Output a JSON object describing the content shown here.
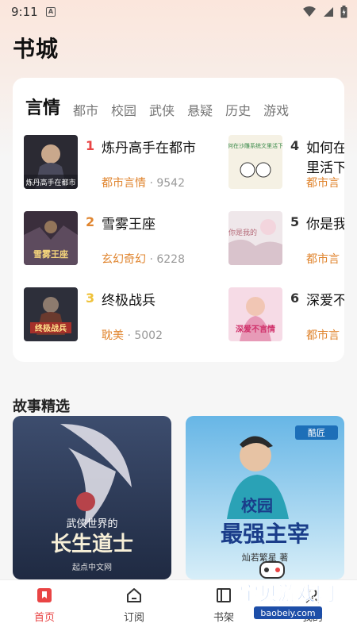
{
  "status": {
    "time": "9:11",
    "app_icon": "A"
  },
  "page_title": "书城",
  "tabs": [
    "言情",
    "都市",
    "校园",
    "武侠",
    "悬疑",
    "历史",
    "游戏"
  ],
  "books": [
    {
      "rank": "1",
      "title": "炼丹高手在都市",
      "category": "都市言情",
      "count": "9542",
      "rank_color": "#e94444"
    },
    {
      "rank": "2",
      "title": "雪雾王座",
      "category": "玄幻奇幻",
      "count": "6228",
      "rank_color": "#e0852f"
    },
    {
      "rank": "3",
      "title": "终极战兵",
      "category": "耽美",
      "count": "5002",
      "rank_color": "#efc23a"
    },
    {
      "rank": "4",
      "title": "如何在",
      "title_line2": "里活下",
      "category": "都市言",
      "count": "",
      "rank_color": "#333333"
    },
    {
      "rank": "5",
      "title": "你是我",
      "category": "都市言",
      "count": "",
      "rank_color": "#333333"
    },
    {
      "rank": "6",
      "title": "深爱不",
      "category": "都市言",
      "count": "",
      "rank_color": "#333333"
    }
  ],
  "cover_texts": {
    "b1": "炼丹高手在都市",
    "b2": "雪雾王座",
    "b3": "终极战兵",
    "b4": "如何在沙雕系统文里活下去",
    "b5": "你是我的",
    "b6": "深爱不言情"
  },
  "section_title": "故事精选",
  "stories": [
    {
      "cover_title_small": "武侠世界的",
      "cover_title_big": "长生道士",
      "publisher": "起点中文网"
    },
    {
      "cover_badge": "酷匠",
      "cover_title_small": "校园",
      "cover_title_big": "最强主宰",
      "author": "灿若繁星 著"
    }
  ],
  "nav": [
    {
      "label": "首页",
      "icon": "bookmark-icon",
      "active": true
    },
    {
      "label": "订阅",
      "icon": "home-icon",
      "active": false
    },
    {
      "label": "书架",
      "icon": "bookshelf-icon",
      "active": false
    },
    {
      "label": "我的",
      "icon": "user-icon",
      "active": false
    }
  ],
  "watermark": {
    "title": "宝贝游戏网",
    "url": "baobeiy.com"
  },
  "colors": {
    "accent": "#e94444",
    "category": "#e0852f",
    "rank1": "#e94444",
    "rank2": "#e0852f",
    "rank3": "#efc23a"
  }
}
